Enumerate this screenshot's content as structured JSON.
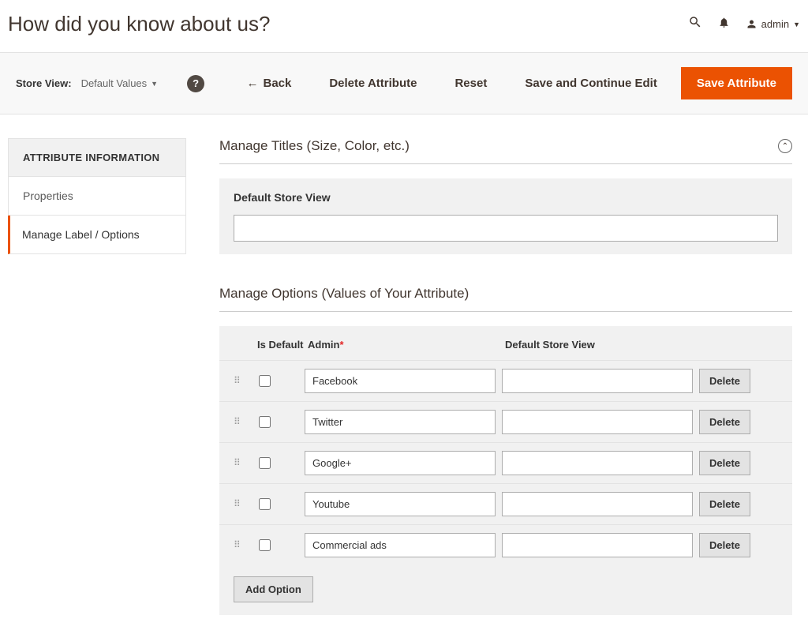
{
  "header": {
    "title": "How did you know about us?",
    "admin_label": "admin"
  },
  "toolbar": {
    "store_view_label": "Store View:",
    "store_view_value": "Default Values",
    "back_label": "Back",
    "delete_attribute_label": "Delete Attribute",
    "reset_label": "Reset",
    "save_continue_label": "Save and Continue Edit",
    "save_attribute_label": "Save Attribute"
  },
  "sidebar": {
    "header": "ATTRIBUTE INFORMATION",
    "items": [
      {
        "label": "Properties",
        "active": false
      },
      {
        "label": "Manage Label / Options",
        "active": true
      }
    ]
  },
  "titles_section": {
    "title": "Manage Titles (Size, Color, etc.)",
    "field_label": "Default Store View",
    "field_value": ""
  },
  "options_section": {
    "title": "Manage Options (Values of Your Attribute)",
    "columns": {
      "is_default": "Is Default",
      "admin": "Admin",
      "required_mark": "*",
      "default_store": "Default Store View"
    },
    "rows": [
      {
        "admin": "Facebook",
        "store": "",
        "is_default": false
      },
      {
        "admin": "Twitter",
        "store": "",
        "is_default": false
      },
      {
        "admin": "Google+",
        "store": "",
        "is_default": false
      },
      {
        "admin": "Youtube",
        "store": "",
        "is_default": false
      },
      {
        "admin": "Commercial ads",
        "store": "",
        "is_default": false
      }
    ],
    "delete_label": "Delete",
    "add_option_label": "Add Option"
  }
}
